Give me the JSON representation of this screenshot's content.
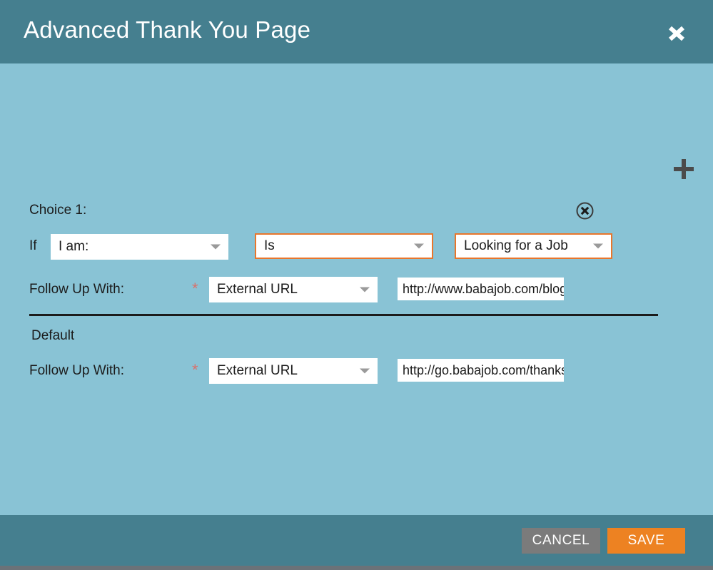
{
  "header": {
    "title": "Advanced Thank You Page",
    "close_icon": "close-icon",
    "background_color": "#457f8f"
  },
  "body": {
    "background_color": "#89c3d5",
    "add_icon": "plus-icon",
    "choice": {
      "label": "Choice 1:",
      "remove_icon": "circle-x-icon",
      "if_label": "If",
      "condition": {
        "field": {
          "value": "I am:",
          "highlighted": false
        },
        "operator": {
          "value": "Is",
          "highlighted": true,
          "highlight_color": "#e8762c"
        },
        "target": {
          "value": "Looking for a Job",
          "highlighted": true,
          "highlight_color": "#e8762c"
        }
      },
      "follow_up": {
        "label": "Follow Up With:",
        "required_marker": "*",
        "required_color": "#d9716b",
        "action": "External URL",
        "url_value": "http://www.babajob.com/blog",
        "url_placeholder": "http://"
      }
    },
    "default_section": {
      "label": "Default",
      "follow_up": {
        "label": "Follow Up With:",
        "required_marker": "*",
        "required_color": "#d9716b",
        "action": "External URL",
        "url_value": "http://go.babajob.com/thanks",
        "url_placeholder": "http://"
      }
    }
  },
  "footer": {
    "background_color": "#457f8f",
    "cancel_label": "CANCEL",
    "cancel_color": "#7b7b7b",
    "save_label": "SAVE",
    "save_color": "#ed8222"
  }
}
